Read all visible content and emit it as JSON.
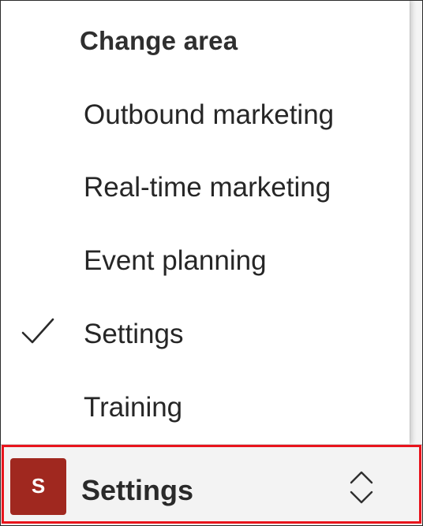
{
  "flyout": {
    "title": "Change area",
    "items": [
      {
        "label": "Outbound marketing",
        "selected": false
      },
      {
        "label": "Real-time marketing",
        "selected": false
      },
      {
        "label": "Event planning",
        "selected": false
      },
      {
        "label": "Settings",
        "selected": true
      },
      {
        "label": "Training",
        "selected": false
      }
    ],
    "check_icon": "checkmark-icon"
  },
  "area_switcher": {
    "avatar_letter": "S",
    "avatar_color": "#a0281f",
    "label": "Settings",
    "icon": "chevron-up-down-icon"
  },
  "colors": {
    "highlight_border": "#e8141c",
    "bar_background": "#f3f3f3"
  }
}
